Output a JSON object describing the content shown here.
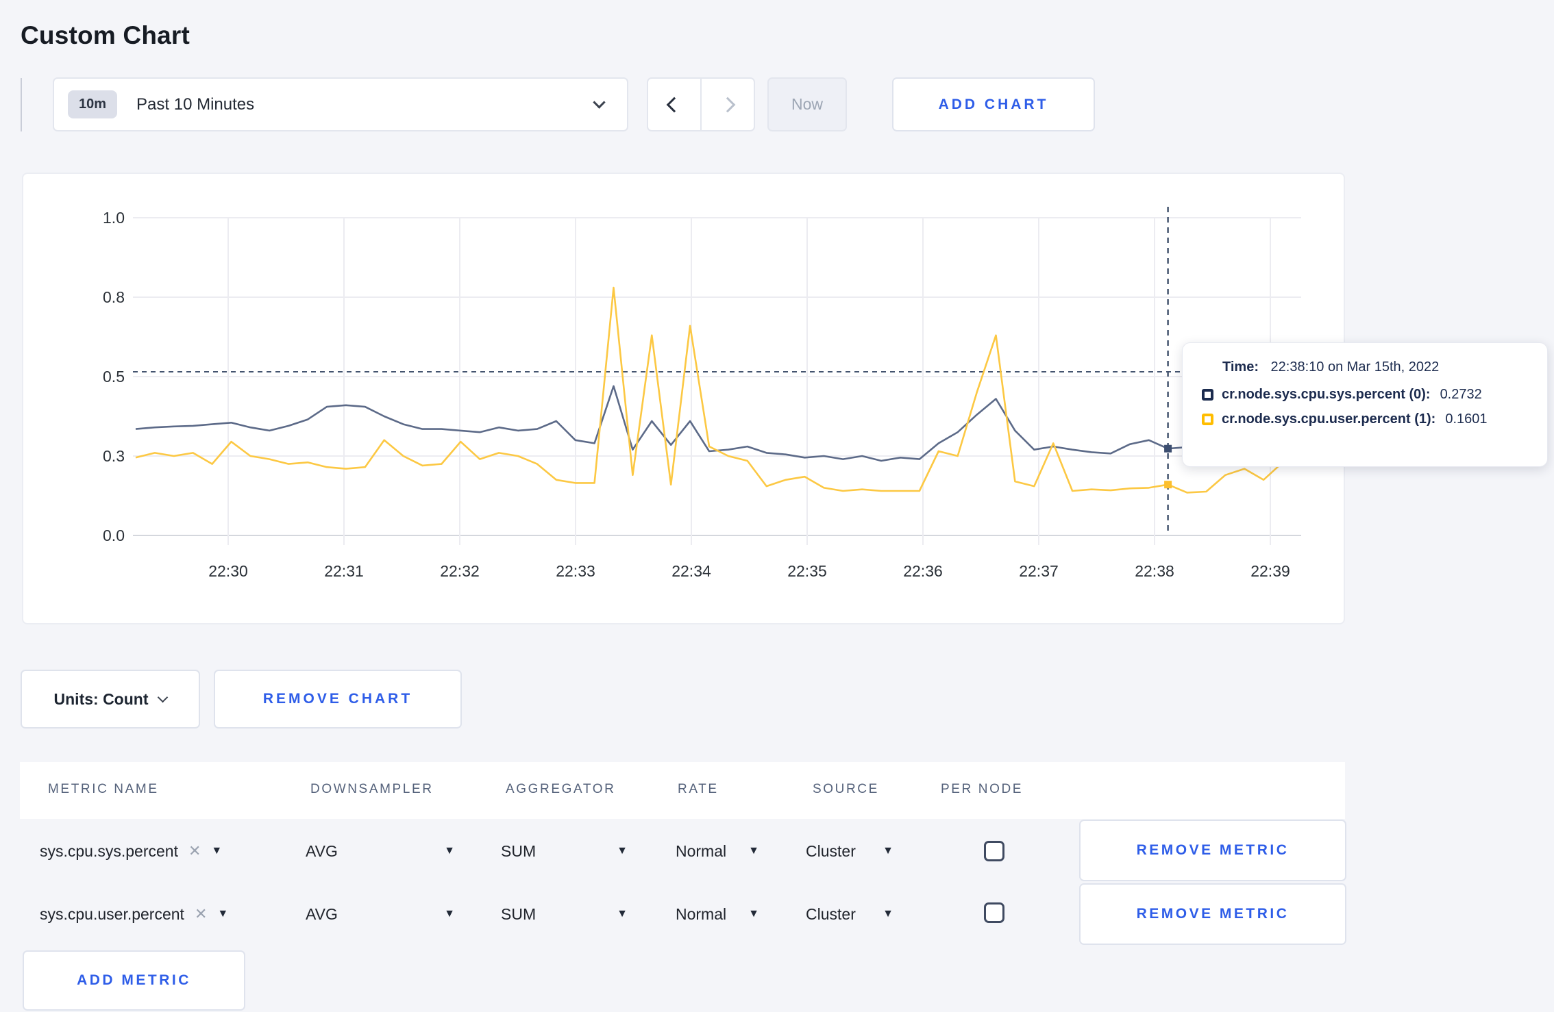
{
  "page": {
    "title": "Custom Chart"
  },
  "colors": {
    "accent_blue": "#2e5de8",
    "series_sys_line": "#5c6a88",
    "series_sys_swatch": "#1b2b4e",
    "series_user_line": "#fcc843",
    "series_user_swatch": "#ffbd00",
    "page_background": "#f4f5f9"
  },
  "toolbar": {
    "time_range_badge": "10m",
    "time_range_label": "Past 10 Minutes",
    "now_label": "Now",
    "add_chart_label": "ADD CHART"
  },
  "chart_controls": {
    "units_label": "Units: Count",
    "remove_chart_label": "REMOVE CHART"
  },
  "tooltip": {
    "time_label": "Time:",
    "time_value": "22:38:10 on Mar 15th, 2022",
    "series": [
      {
        "name": "cr.node.sys.cpu.sys.percent (0):",
        "value": "0.2732",
        "swatch_color": "#1b2b4e"
      },
      {
        "name": "cr.node.sys.cpu.user.percent (1):",
        "value": "0.1601",
        "swatch_color": "#ffbd00"
      }
    ]
  },
  "metrics_table": {
    "headers": [
      "METRIC NAME",
      "DOWNSAMPLER",
      "AGGREGATOR",
      "RATE",
      "SOURCE",
      "PER NODE"
    ],
    "rows": [
      {
        "metric": "sys.cpu.sys.percent",
        "downsampler": "AVG",
        "aggregator": "SUM",
        "rate": "Normal",
        "source": "Cluster",
        "per_node_checked": false
      },
      {
        "metric": "sys.cpu.user.percent",
        "downsampler": "AVG",
        "aggregator": "SUM",
        "rate": "Normal",
        "source": "Cluster",
        "per_node_checked": false
      }
    ],
    "remove_metric_label": "REMOVE METRIC",
    "add_metric_label": "ADD METRIC"
  },
  "chart_data": {
    "type": "line",
    "title": "",
    "xlabel": "",
    "ylabel": "",
    "ylim": [
      0,
      1
    ],
    "grid": true,
    "x_tick_labels": [
      "22:30",
      "22:31",
      "22:32",
      "22:33",
      "22:34",
      "22:35",
      "22:36",
      "22:37",
      "22:38",
      "22:39"
    ],
    "y_ticks": [
      {
        "label": "0.0",
        "value": 0.0
      },
      {
        "label": "0.3",
        "value": 0.25
      },
      {
        "label": "0.5",
        "value": 0.5
      },
      {
        "label": "0.8",
        "value": 0.75
      },
      {
        "label": "1.0",
        "value": 1.0
      }
    ],
    "x_start_time": "22:29:10",
    "x_step_seconds": 10,
    "hover_guideline_value": 0.515,
    "crosshair_time": "22:38:10",
    "crosshair_index": 54,
    "series": [
      {
        "name": "cr.node.sys.cpu.sys.percent (0)",
        "color": "#5c6a88",
        "dot_color": "#3c4e70",
        "hover_value": 0.2732,
        "values": [
          0.335,
          0.34,
          0.343,
          0.345,
          0.35,
          0.355,
          0.34,
          0.33,
          0.345,
          0.365,
          0.405,
          0.41,
          0.405,
          0.375,
          0.35,
          0.335,
          0.335,
          0.33,
          0.325,
          0.34,
          0.33,
          0.335,
          0.36,
          0.3,
          0.29,
          0.47,
          0.27,
          0.36,
          0.285,
          0.36,
          0.265,
          0.27,
          0.28,
          0.26,
          0.255,
          0.245,
          0.25,
          0.24,
          0.25,
          0.235,
          0.245,
          0.24,
          0.29,
          0.325,
          0.38,
          0.43,
          0.33,
          0.27,
          0.28,
          0.27,
          0.262,
          0.258,
          0.287,
          0.3,
          0.2732,
          0.278,
          0.29,
          0.285,
          0.28,
          0.275,
          0.285,
          0.3
        ]
      },
      {
        "name": "cr.node.sys.cpu.user.percent (1)",
        "color": "#fcc843",
        "dot_color": "#fcbf2e",
        "hover_value": 0.1601,
        "values": [
          0.245,
          0.26,
          0.25,
          0.26,
          0.225,
          0.295,
          0.25,
          0.24,
          0.225,
          0.23,
          0.215,
          0.21,
          0.215,
          0.3,
          0.25,
          0.22,
          0.225,
          0.295,
          0.24,
          0.26,
          0.25,
          0.225,
          0.175,
          0.165,
          0.165,
          0.78,
          0.19,
          0.63,
          0.16,
          0.66,
          0.28,
          0.25,
          0.235,
          0.155,
          0.175,
          0.185,
          0.15,
          0.14,
          0.145,
          0.14,
          0.14,
          0.14,
          0.265,
          0.25,
          0.45,
          0.63,
          0.17,
          0.155,
          0.29,
          0.14,
          0.145,
          0.142,
          0.148,
          0.15,
          0.1601,
          0.135,
          0.138,
          0.19,
          0.21,
          0.175,
          0.23,
          0.27
        ]
      }
    ],
    "legend_position": "tooltip-only"
  }
}
